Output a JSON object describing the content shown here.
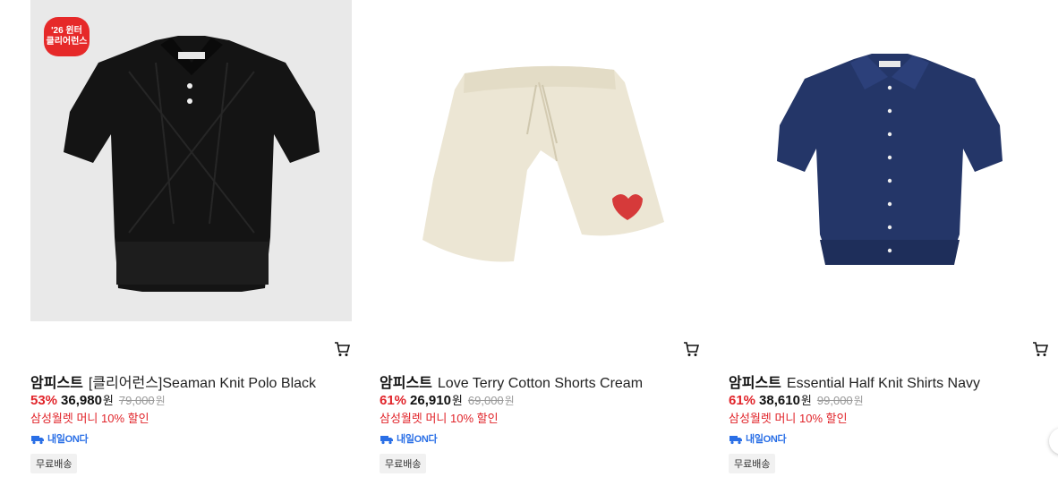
{
  "products": [
    {
      "badge_line1": "'26 윈터",
      "badge_line2": "클리어런스",
      "brand": "암피스트",
      "name": "[클리어런스]Seaman Knit Polo Black",
      "discount": "53%",
      "price": "36,980",
      "currency": "원",
      "original_price": "79,000",
      "original_currency": "원",
      "promo": "삼성월렛 머니 10% 할인",
      "delivery": "내일ON다",
      "shipping": "무료배송"
    },
    {
      "brand": "암피스트",
      "name": "Love Terry Cotton Shorts Cream",
      "discount": "61%",
      "price": "26,910",
      "currency": "원",
      "original_price": "69,000",
      "original_currency": "원",
      "promo": "삼성월렛 머니 10% 할인",
      "delivery": "내일ON다",
      "shipping": "무료배송"
    },
    {
      "brand": "암피스트",
      "name": "Essential Half Knit Shirts Navy",
      "discount": "61%",
      "price": "38,610",
      "currency": "원",
      "original_price": "99,000",
      "original_currency": "원",
      "promo": "삼성월렛 머니 10% 할인",
      "delivery": "내일ON다",
      "shipping": "무료배송"
    }
  ],
  "colors": {
    "discount": "#e1242a",
    "badge": "#e62929",
    "delivery": "#2a6fe6"
  }
}
